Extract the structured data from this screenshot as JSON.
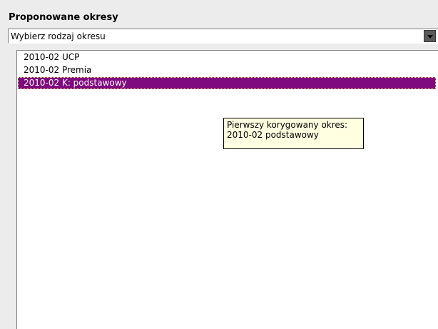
{
  "panel": {
    "title": "Proponowane okresy"
  },
  "combo": {
    "selected_value": "Wybierz rodzaj okresu",
    "button_icon": "chevron-down-icon"
  },
  "list": {
    "items": [
      {
        "label": "2010-02  UCP",
        "selected": false
      },
      {
        "label": "2010-02  Premia",
        "selected": false
      },
      {
        "label": "2010-02  K: podstawowy",
        "selected": true
      }
    ],
    "selection_color": "#7f0a7f"
  },
  "tooltip": {
    "line1": "Pierwszy korygowany okres:",
    "line2": "2010-02  podstawowy"
  }
}
